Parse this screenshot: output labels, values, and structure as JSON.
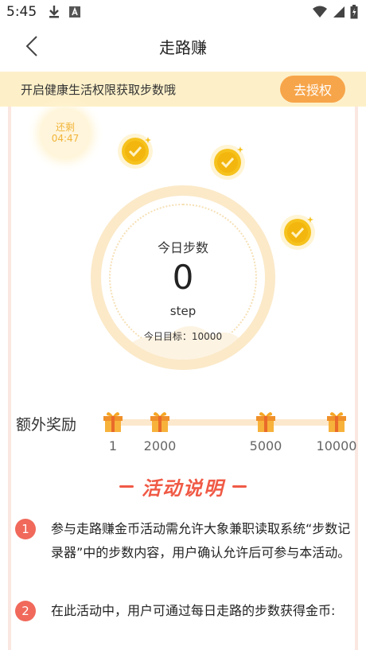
{
  "status_bar": {
    "time": "5:45",
    "icons": [
      "download-icon",
      "font-a-icon",
      "wifi-icon",
      "signal-icon",
      "battery-icon"
    ]
  },
  "nav": {
    "title": "走路赚",
    "back_icon": "chevron-left-icon"
  },
  "auth_banner": {
    "text": "开启健康生活权限获取步数哦",
    "button_label": "去授权"
  },
  "timer": {
    "label": "还剩",
    "value": "04:47"
  },
  "step_ring": {
    "title": "今日步数",
    "steps": "0",
    "unit": "step",
    "goal": "今日目标：10000"
  },
  "rewards": {
    "title": "额外奖励",
    "milestones": [
      "1",
      "2000",
      "5000",
      "10000"
    ]
  },
  "activity": {
    "title": "活动说明",
    "rules": [
      {
        "num": "1",
        "text": "参与走路赚金币活动需允许大象兼职读取系统“步数记录器”中的步数内容，用户确认允许后可参与本活动。"
      },
      {
        "num": "2",
        "text": "在此活动中，用户可通过每日走路的步数获得金币:"
      }
    ]
  },
  "colors": {
    "accent_orange": "#f7a54a",
    "banner_bg": "#fdf0c9",
    "coin_gold": "#f6c21c",
    "title_red": "#f05a46"
  }
}
